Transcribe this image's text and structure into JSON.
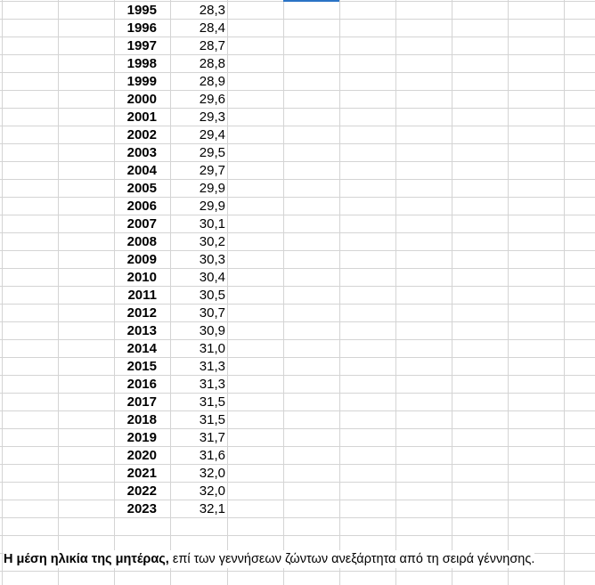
{
  "rows": [
    {
      "year": "1995",
      "age": "28,3"
    },
    {
      "year": "1996",
      "age": "28,4"
    },
    {
      "year": "1997",
      "age": "28,7"
    },
    {
      "year": "1998",
      "age": "28,8"
    },
    {
      "year": "1999",
      "age": "28,9"
    },
    {
      "year": "2000",
      "age": "29,6"
    },
    {
      "year": "2001",
      "age": "29,3"
    },
    {
      "year": "2002",
      "age": "29,4"
    },
    {
      "year": "2003",
      "age": "29,5"
    },
    {
      "year": "2004",
      "age": "29,7"
    },
    {
      "year": "2005",
      "age": "29,9"
    },
    {
      "year": "2006",
      "age": "29,9"
    },
    {
      "year": "2007",
      "age": "30,1"
    },
    {
      "year": "2008",
      "age": "30,2"
    },
    {
      "year": "2009",
      "age": "30,3"
    },
    {
      "year": "2010",
      "age": "30,4"
    },
    {
      "year": "2011",
      "age": "30,5"
    },
    {
      "year": "2012",
      "age": "30,7"
    },
    {
      "year": "2013",
      "age": "30,9"
    },
    {
      "year": "2014",
      "age": "31,0"
    },
    {
      "year": "2015",
      "age": "31,3"
    },
    {
      "year": "2016",
      "age": "31,3"
    },
    {
      "year": "2017",
      "age": "31,5"
    },
    {
      "year": "2018",
      "age": "31,5"
    },
    {
      "year": "2019",
      "age": "31,7"
    },
    {
      "year": "2020",
      "age": "31,6"
    },
    {
      "year": "2021",
      "age": "32,0"
    },
    {
      "year": "2022",
      "age": "32,0"
    },
    {
      "year": "2023",
      "age": "32,1"
    }
  ],
  "footnote": {
    "bold_part": "Η μέση ηλικία της μητέρας,",
    "rest": " επί των γεννήσεων ζώντων ανεξάρτητα από τη σειρά γέννησης."
  },
  "colors": {
    "gridline": "#d4d4d4",
    "selection": "#2a73c5"
  }
}
